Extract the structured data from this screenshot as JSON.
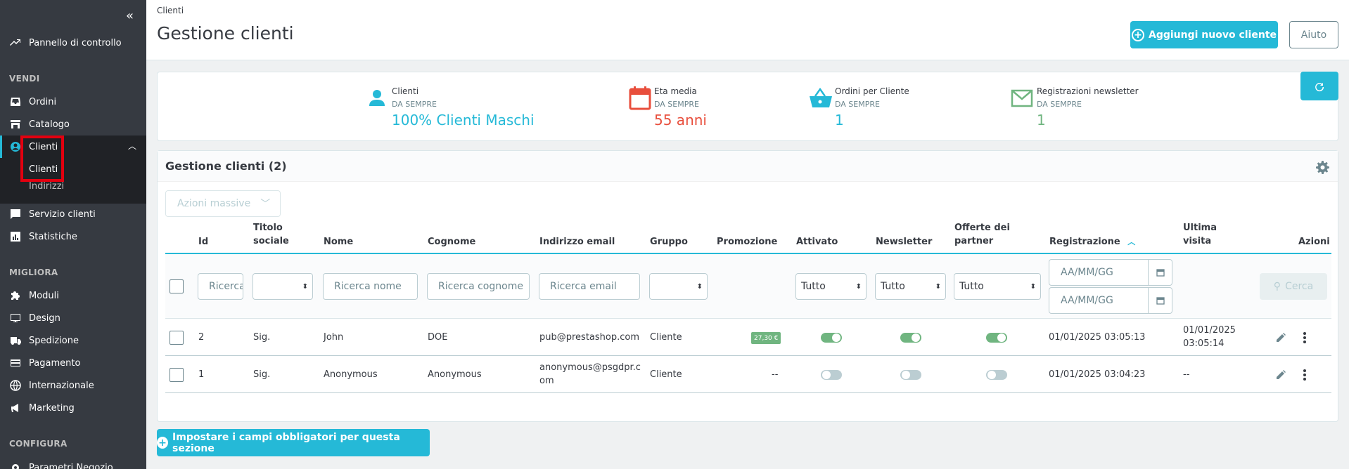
{
  "sidebar": {
    "collapse_label": "«",
    "dashboard": "Pannello di controllo",
    "sections": {
      "vendi": "VENDI",
      "migliora": "MIGLIORA",
      "configura": "CONFIGURA"
    },
    "items": {
      "ordini": "Ordini",
      "catalogo": "Catalogo",
      "clienti": "Clienti",
      "servizio_clienti": "Servizio clienti",
      "statistiche": "Statistiche",
      "moduli": "Moduli",
      "design": "Design",
      "spedizione": "Spedizione",
      "pagamento": "Pagamento",
      "internazionale": "Internazionale",
      "marketing": "Marketing",
      "parametri": "Parametri Negozio"
    },
    "subitems": {
      "clienti": "Clienti",
      "indirizzi": "Indirizzi"
    },
    "accent": "#25b9d7"
  },
  "header": {
    "breadcrumb": "Clienti",
    "title": "Gestione clienti",
    "add_button": "Aggiungi nuovo cliente",
    "help_button": "Aiuto"
  },
  "kpis": [
    {
      "label": "Clienti",
      "sub": "DA SEMPRE",
      "value": "100% Clienti Maschi",
      "color": "#25b9d7",
      "icon": "user-icon"
    },
    {
      "label": "Eta media",
      "sub": "DA SEMPRE",
      "value": "55 anni",
      "color": "#e84e3c",
      "icon": "calendar-icon"
    },
    {
      "label": "Ordini per Cliente",
      "sub": "DA SEMPRE",
      "value": "1",
      "color": "#25b9d7",
      "icon": "basket-icon"
    },
    {
      "label": "Registrazioni newsletter",
      "sub": "DA SEMPRE",
      "value": "1",
      "color": "#70b580",
      "icon": "envelope-icon"
    }
  ],
  "table": {
    "title": "Gestione clienti (2)",
    "bulk_actions": "Azioni massive",
    "columns": {
      "id": "Id",
      "titolo_1": "Titolo",
      "titolo_2": "sociale",
      "nome": "Nome",
      "cognome": "Cognome",
      "email": "Indirizzo email",
      "gruppo": "Gruppo",
      "promozione": "Promozione",
      "attivato": "Attivato",
      "newsletter": "Newsletter",
      "offerte_1": "Offerte dei",
      "offerte_2": "partner",
      "registrazione": "Registrazione",
      "ultima_1": "Ultima",
      "ultima_2": "visita",
      "azioni": "Azioni"
    },
    "filters": {
      "id_placeholder": "Ricerca ID",
      "nome_placeholder": "Ricerca nome",
      "cognome_placeholder": "Ricerca cognome",
      "email_placeholder": "Ricerca email",
      "attivato": "Tutto",
      "newsletter": "Tutto",
      "offerte": "Tutto",
      "date_from": "AA/MM/GG",
      "date_to": "AA/MM/GG",
      "search_button": "Cerca"
    },
    "rows": [
      {
        "id": "2",
        "titolo": "Sig.",
        "nome": "John",
        "cognome": "DOE",
        "email_1": "pub@prestashop.com",
        "email_2": "",
        "gruppo": "Cliente",
        "promozione": "27,30 €",
        "attivato": true,
        "newsletter": true,
        "offerte": true,
        "registrazione": "01/01/2025 03:05:13",
        "ultima_1": "01/01/2025",
        "ultima_2": "03:05:14"
      },
      {
        "id": "1",
        "titolo": "Sig.",
        "nome": "Anonymous",
        "cognome": "Anonymous",
        "email_1": "anonymous@psgdpr.c",
        "email_2": "om",
        "gruppo": "Cliente",
        "promozione": "--",
        "attivato": false,
        "newsletter": false,
        "offerte": false,
        "registrazione": "01/01/2025 03:04:23",
        "ultima_1": "--",
        "ultima_2": ""
      }
    ]
  },
  "footer_button": "Impostare i campi obbligatori per questa sezione"
}
